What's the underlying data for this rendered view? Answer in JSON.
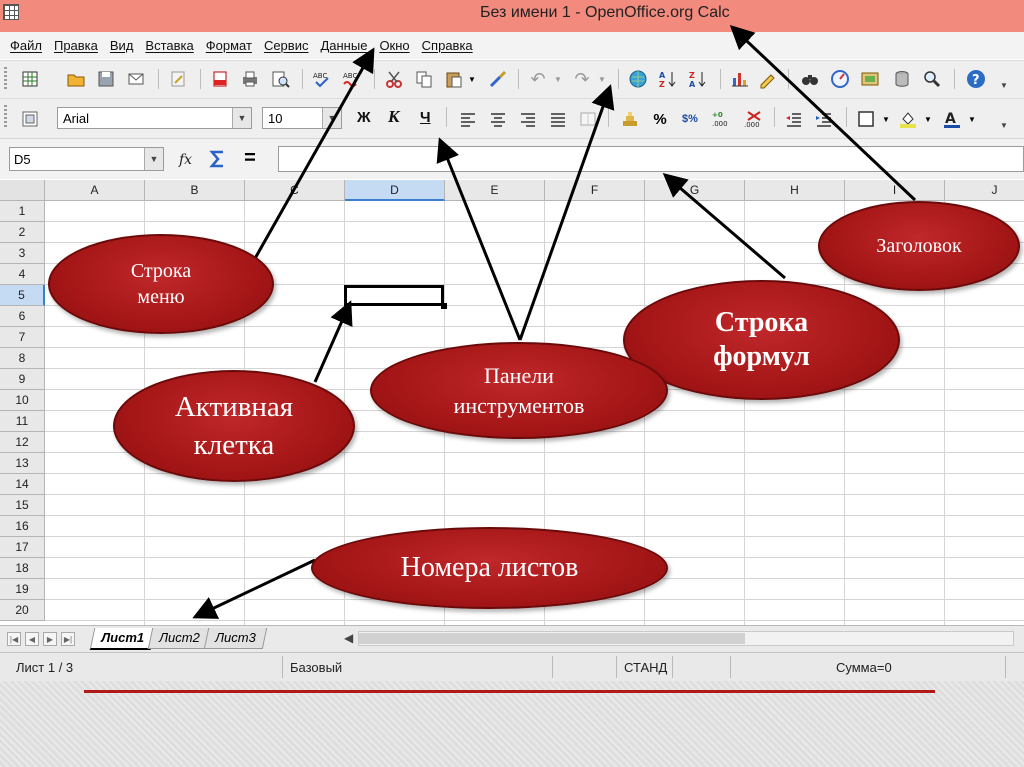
{
  "window": {
    "title": "Без имени 1 - OpenOffice.org Calc"
  },
  "menu": [
    "Файл",
    "Правка",
    "Вид",
    "Вставка",
    "Формат",
    "Сервис",
    "Данные",
    "Окно",
    "Справка"
  ],
  "format_toolbar": {
    "font_name": "Arial",
    "font_size": "10",
    "bold": "Ж",
    "italic": "К",
    "underline": "Ч",
    "percent": "%",
    "currency": "$%"
  },
  "formula_bar": {
    "name_box": "D5",
    "equals": "="
  },
  "grid": {
    "columns": [
      "A",
      "B",
      "C",
      "D",
      "E",
      "F",
      "G",
      "H",
      "I",
      "J"
    ],
    "rows": [
      "1",
      "2",
      "3",
      "4",
      "5",
      "6",
      "7",
      "8",
      "9",
      "10",
      "11",
      "12",
      "13",
      "14",
      "15",
      "16",
      "17",
      "18",
      "19",
      "20"
    ],
    "active_column": "D",
    "active_row": "5"
  },
  "sheet_tabs": [
    "Лист1",
    "Лист2",
    "Лист3"
  ],
  "active_sheet": "Лист1",
  "status_bar": {
    "sheet": "Лист 1 / 3",
    "style": "Базовый",
    "mode": "СТАНД",
    "sum": "Сумма=0"
  },
  "annotations": {
    "menu_row": "Строка меню",
    "title": "Заголовок",
    "formula_row": "Строка формул",
    "toolbars": "Панели инструментов",
    "active_cell": "Активная клетка",
    "sheet_numbers": "Номера листов"
  },
  "colors": {
    "titlebar": "#f28a7e",
    "callout": "#a51617",
    "accent_line": "#b21a1a"
  }
}
